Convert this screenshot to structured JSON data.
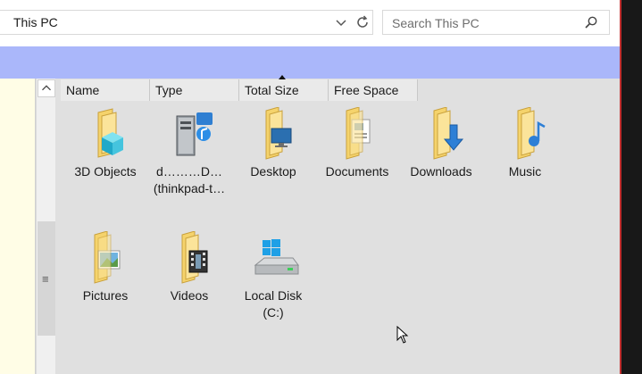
{
  "address": {
    "path": "This PC"
  },
  "search": {
    "placeholder": "Search This PC"
  },
  "columns": [
    "Name",
    "Type",
    "Total Size",
    "Free Space"
  ],
  "items": [
    {
      "label": "3D Objects",
      "icon": "3d-objects-folder-icon"
    },
    {
      "label": "d………D…",
      "sublabel": "(thinkpad-t…",
      "icon": "media-server-icon"
    },
    {
      "label": "Desktop",
      "icon": "desktop-folder-icon"
    },
    {
      "label": "Documents",
      "icon": "documents-folder-icon"
    },
    {
      "label": "Downloads",
      "icon": "downloads-folder-icon"
    },
    {
      "label": "Music",
      "icon": "music-folder-icon"
    },
    {
      "label": "Pictures",
      "icon": "pictures-folder-icon"
    },
    {
      "label": "Videos",
      "icon": "videos-folder-icon"
    },
    {
      "label": "Local Disk",
      "sublabel": "(C:)",
      "icon": "local-disk-icon"
    }
  ],
  "colors": {
    "ribbon": "#aab7fa",
    "content_bg": "#e0e0e0",
    "nav_bg": "#fffde6",
    "folder": "#f5d36c"
  }
}
